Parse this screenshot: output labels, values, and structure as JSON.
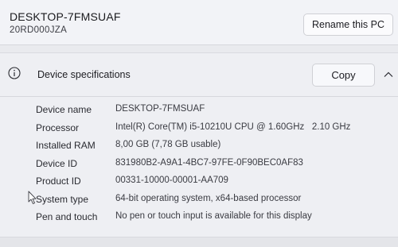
{
  "header": {
    "device_name": "DESKTOP-7FMSUAF",
    "model": "20RD000JZA",
    "rename_label": "Rename this PC"
  },
  "specs": {
    "title": "Device specifications",
    "copy_label": "Copy",
    "rows": [
      {
        "label": "Device name",
        "value": "DESKTOP-7FMSUAF"
      },
      {
        "label": "Processor",
        "value": "Intel(R) Core(TM) i5-10210U CPU @ 1.60GHz   2.10 GHz"
      },
      {
        "label": "Installed RAM",
        "value": "8,00 GB (7,78 GB usable)"
      },
      {
        "label": "Device ID",
        "value": "831980B2-A9A1-4BC7-97FE-0F90BEC0AF83"
      },
      {
        "label": "Product ID",
        "value": "00331-10000-00001-AA709"
      },
      {
        "label": "System type",
        "value": "64-bit operating system, x64-based processor"
      },
      {
        "label": "Pen and touch",
        "value": "No pen or touch input is available for this display"
      }
    ]
  },
  "icons": {
    "info": "info-icon",
    "collapse": "chevron-up-icon",
    "pointer": "mouse-cursor-icon"
  }
}
